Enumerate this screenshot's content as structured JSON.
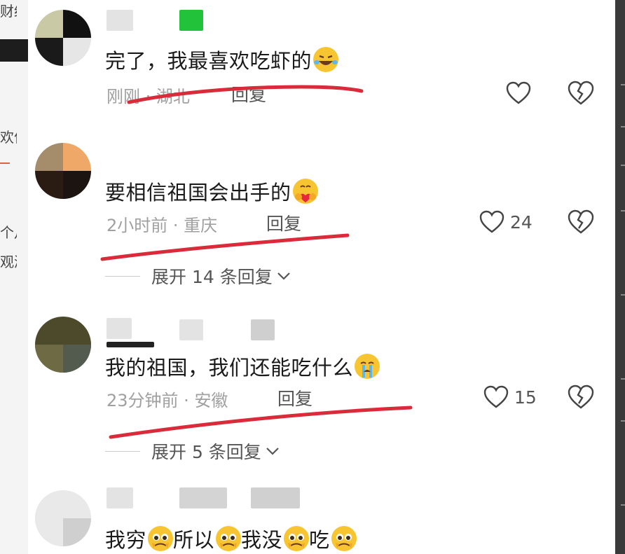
{
  "background_fragments": [
    "财经",
    "欢俳",
    "个月",
    "观测"
  ],
  "comments": [
    {
      "text": "完了，我最喜欢吃虾的",
      "emoji": "rofl-emoji",
      "time": "刚刚",
      "location": "湖北",
      "reply_label": "回复",
      "likes": "",
      "expand_label": ""
    },
    {
      "text": "要相信祖国会出手的",
      "emoji": "hug-emoji",
      "time": "2小时前",
      "location": "重庆",
      "reply_label": "回复",
      "likes": "24",
      "expand_label": "展开 14 条回复"
    },
    {
      "text": "我的祖国，我们还能吃什么",
      "emoji": "crying-emoji",
      "time": "23分钟前",
      "location": "安徽",
      "reply_label": "回复",
      "likes": "15",
      "expand_label": "展开 5 条回复"
    },
    {
      "text_parts": [
        "我穷",
        "所以",
        "我没",
        "吃"
      ],
      "emoji": "pleading-emoji"
    }
  ],
  "colors": {
    "annotation_red": "#d92b3a",
    "text": "#1a1a1a",
    "meta": "#a0a0a0",
    "accent_green": "#22c33a"
  }
}
